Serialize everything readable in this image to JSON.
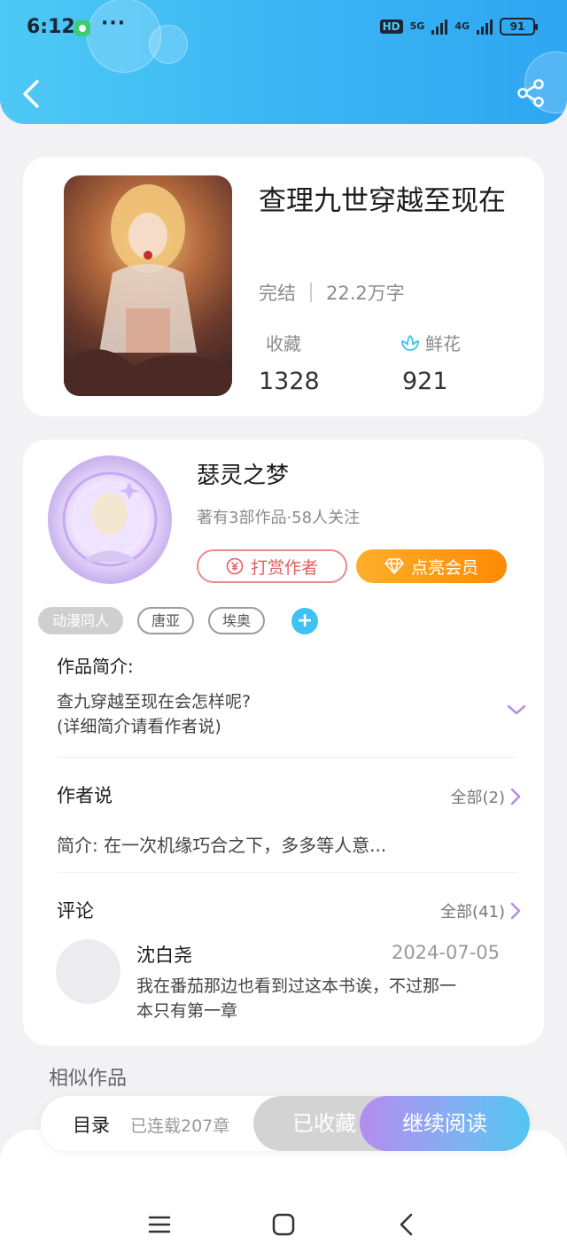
{
  "status_bar": {
    "time": "6:12",
    "dots": "···",
    "hd": "HD",
    "net1": "5G",
    "net2": "4G",
    "battery": "91"
  },
  "book": {
    "title": "查理九世穿越至现在",
    "status": "完结",
    "word_count": "22.2万字",
    "favorites_label": "收藏",
    "favorites_value": "1328",
    "flowers_label": "鲜花",
    "flowers_value": "921"
  },
  "author": {
    "name": "瑟灵之梦",
    "stats": "著有3部作品·58人关注",
    "reward_label": "打赏作者",
    "vip_label": "点亮会员",
    "tags": [
      "动漫同人",
      "唐亚",
      "埃奥"
    ]
  },
  "intro": {
    "title": "作品简介:",
    "line1": "查九穿越至现在会怎样呢?",
    "line2": "(详细简介请看作者说)"
  },
  "author_says": {
    "title": "作者说",
    "more": "全部(2)",
    "text": "简介: 在一次机缘巧合之下，多多等人意..."
  },
  "comments": {
    "title": "评论",
    "more": "全部(41)",
    "items": [
      {
        "user": "沈白尧",
        "date": "2024-07-05",
        "line1": "我在番茄那边也看到过这本书诶，不过那一",
        "line2": "本只有第一章"
      }
    ]
  },
  "similar": {
    "title": "相似作品"
  },
  "action_bar": {
    "toc": "目录",
    "chapters": "已连载207章",
    "collected": "已收藏",
    "continue": "继续阅读"
  },
  "colors": {
    "header_start": "#4ec9f5",
    "header_end": "#2ea6f2",
    "accent_blue": "#3ec2f2",
    "reward_red": "#e0605e",
    "vip_orange": "#ff8a05",
    "expand_purple": "#b58be8"
  },
  "icons": [
    "back-arrow-icon",
    "share-icon",
    "flower-icon",
    "yen-coin-icon",
    "diamond-icon",
    "plus-icon",
    "chevron-down-icon",
    "chevron-right-icon",
    "menu-icon",
    "home-square-icon",
    "nav-back-icon"
  ]
}
